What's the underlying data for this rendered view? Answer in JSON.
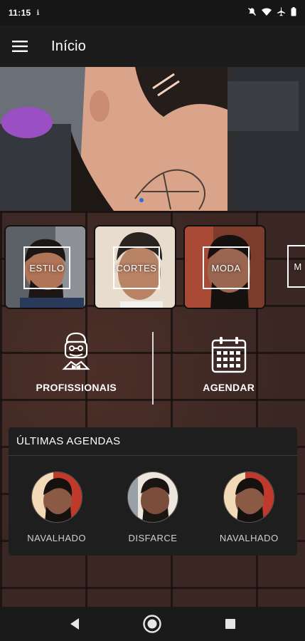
{
  "status_bar": {
    "time": "11:15",
    "notification": "ℹ",
    "icons": [
      "mute-icon",
      "wifi-icon",
      "airplane-icon",
      "battery-icon"
    ]
  },
  "app_bar": {
    "title": "Início",
    "menu_icon": "menu-icon"
  },
  "categories": [
    {
      "label": "ESTILO"
    },
    {
      "label": "CORTES"
    },
    {
      "label": "MODA"
    },
    {
      "label": "M"
    }
  ],
  "actions": {
    "professionals_label": "PROFISSIONAIS",
    "professionals_icon": "barber-icon",
    "schedule_label": "AGENDAR",
    "schedule_icon": "calendar-icon"
  },
  "recent": {
    "title": "ÚLTIMAS AGENDAS",
    "items": [
      {
        "name": "NAVALHADO"
      },
      {
        "name": "DISFARCE"
      },
      {
        "name": "NAVALHADO"
      }
    ]
  },
  "nav_bar": {
    "icons": [
      "back-icon",
      "home-icon",
      "recents-icon"
    ]
  },
  "colors": {
    "status_bar": "#161616",
    "app_bar": "#1c1c1c",
    "card": "#1e1e1e",
    "brick": "#3a2723"
  }
}
